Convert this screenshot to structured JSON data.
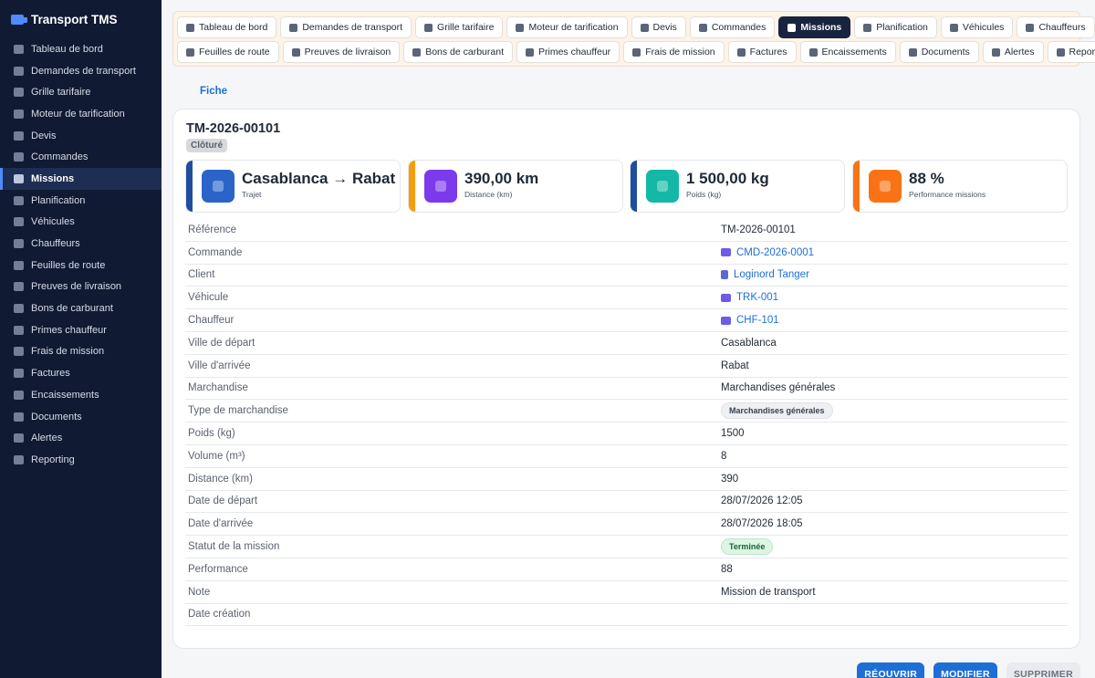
{
  "app": {
    "title": "Transport TMS"
  },
  "sidebar": {
    "items": [
      {
        "label": "Tableau de bord",
        "icon": "dashboard-icon"
      },
      {
        "label": "Demandes de transport",
        "icon": "request-icon"
      },
      {
        "label": "Grille tarifaire",
        "icon": "tag-icon"
      },
      {
        "label": "Moteur de tarification",
        "icon": "calculator-icon"
      },
      {
        "label": "Devis",
        "icon": "document-icon"
      },
      {
        "label": "Commandes",
        "icon": "cart-icon"
      },
      {
        "label": "Missions",
        "icon": "truck-icon",
        "active": true
      },
      {
        "label": "Planification",
        "icon": "calendar-icon"
      },
      {
        "label": "Véhicules",
        "icon": "truck-icon"
      },
      {
        "label": "Chauffeurs",
        "icon": "id-card-icon"
      },
      {
        "label": "Feuilles de route",
        "icon": "route-icon"
      },
      {
        "label": "Preuves de livraison",
        "icon": "clipboard-check-icon"
      },
      {
        "label": "Bons de carburant",
        "icon": "fuel-icon"
      },
      {
        "label": "Primes chauffeur",
        "icon": "gift-icon"
      },
      {
        "label": "Frais de mission",
        "icon": "receipt-icon"
      },
      {
        "label": "Factures",
        "icon": "invoice-icon"
      },
      {
        "label": "Encaissements",
        "icon": "money-icon"
      },
      {
        "label": "Documents",
        "icon": "paperclip-icon"
      },
      {
        "label": "Alertes",
        "icon": "bell-icon"
      },
      {
        "label": "Reporting",
        "icon": "pie-chart-icon"
      }
    ]
  },
  "modules": {
    "row1": [
      {
        "label": "Tableau de bord"
      },
      {
        "label": "Demandes de transport"
      },
      {
        "label": "Grille tarifaire"
      },
      {
        "label": "Moteur de tarification"
      },
      {
        "label": "Devis"
      },
      {
        "label": "Commandes"
      },
      {
        "label": "Missions",
        "active": true
      },
      {
        "label": "Planification"
      },
      {
        "label": "Véhicules"
      },
      {
        "label": "Chauffeurs"
      }
    ],
    "row2": [
      {
        "label": "Feuilles de route"
      },
      {
        "label": "Preuves de livraison"
      },
      {
        "label": "Bons de carburant"
      },
      {
        "label": "Primes chauffeur"
      },
      {
        "label": "Frais de mission"
      },
      {
        "label": "Factures"
      },
      {
        "label": "Encaissements"
      },
      {
        "label": "Documents"
      },
      {
        "label": "Alertes"
      },
      {
        "label": "Reporting"
      }
    ]
  },
  "tabs": {
    "fiche": "Fiche"
  },
  "record": {
    "reference": "TM-2026-00101",
    "status_badge": "Clôturé"
  },
  "kpis": [
    {
      "value": "Casablanca → Rabat",
      "label": "Trajet",
      "color": "#2b64c9",
      "stripe": "#1f4e9e"
    },
    {
      "value": "390,00 km",
      "label": "Distance (km)",
      "color": "#7c3aed",
      "stripe": "#f59e0b"
    },
    {
      "value": "1 500,00 kg",
      "label": "Poids (kg)",
      "color": "#14b8a6",
      "stripe": "#1f4e9e"
    },
    {
      "value": "88 %",
      "label": "Performance missions",
      "color": "#f97316",
      "stripe": "#f97316"
    }
  ],
  "fields": [
    {
      "label": "Référence",
      "value": "TM-2026-00101"
    },
    {
      "label": "Commande",
      "value": "CMD-2026-0001",
      "type": "link"
    },
    {
      "label": "Client",
      "value": "Loginord Tanger",
      "type": "link-building"
    },
    {
      "label": "Véhicule",
      "value": "TRK-001",
      "type": "link"
    },
    {
      "label": "Chauffeur",
      "value": "CHF-101",
      "type": "link"
    },
    {
      "label": "Ville de départ",
      "value": "Casablanca"
    },
    {
      "label": "Ville d'arrivée",
      "value": "Rabat"
    },
    {
      "label": "Marchandise",
      "value": "Marchandises générales"
    },
    {
      "label": "Type de marchandise",
      "value": "Marchandises générales",
      "type": "chip-grey"
    },
    {
      "label": "Poids (kg)",
      "value": "1500"
    },
    {
      "label": "Volume (m³)",
      "value": "8"
    },
    {
      "label": "Distance (km)",
      "value": "390"
    },
    {
      "label": "Date de départ",
      "value": "28/07/2026 12:05"
    },
    {
      "label": "Date d'arrivée",
      "value": "28/07/2026 18:05"
    },
    {
      "label": "Statut de la mission",
      "value": "Terminée",
      "type": "chip-green"
    },
    {
      "label": "Performance",
      "value": "88"
    },
    {
      "label": "Note",
      "value": "Mission de transport"
    },
    {
      "label": "Date création",
      "value": ""
    }
  ],
  "actions": {
    "reopen": "RÉOUVRIR",
    "edit": "MODIFIER",
    "delete": "SUPPRIMER"
  }
}
